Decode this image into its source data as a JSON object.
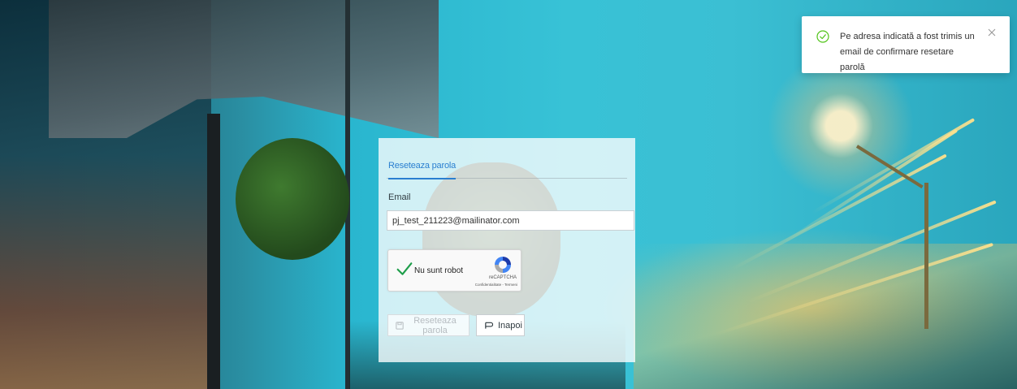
{
  "colors": {
    "accent": "#2a7fd0",
    "success": "#52c41a",
    "captcha_check": "#1e9e4a"
  },
  "form": {
    "tab_label": "Reseteaza parola",
    "email_label": "Email",
    "email_value": "pj_test_211223@mailinator.com",
    "reset_button_label": "Reseteaza parola",
    "back_button_label": "Inapoi"
  },
  "captcha": {
    "label": "Nu sunt robot",
    "brand": "reCAPTCHA",
    "links": "Confidentialitate - Termeni"
  },
  "toast": {
    "message": "Pe adresa indicată a fost trimis un email de confirmare resetare parolă",
    "icon": "check-circle-icon",
    "close_icon": "close-icon"
  }
}
